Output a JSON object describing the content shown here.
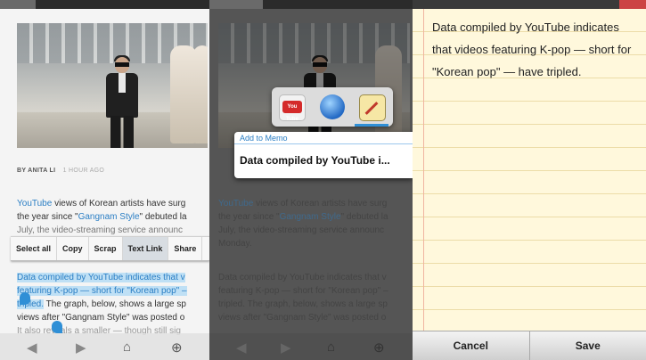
{
  "article": {
    "byline_author": "BY ANITA LI",
    "byline_time": "1 HOUR AGO",
    "para1_line1_link": "YouTube",
    "para1_line1_rest": " views of Korean artists have surg",
    "para1_line2_pre": "the year since \"",
    "para1_line2_link": "Gangnam Style",
    "para1_line2_post": "\" debuted la",
    "para1_line3": "July, the video-streaming service announc",
    "para1_line4": "Monday.",
    "para2_line1": "Data compiled by YouTube indicates that v",
    "para2_line2": "featuring K-pop — short for \"Korean pop\" –",
    "para2_line3_hl": "tripled.",
    "para2_line3_rest": " The graph, below, shows a large sp",
    "para2_line4": "views after \"Gangnam Style\" was posted o",
    "para2_line5": "It also reveals a smaller — though still sig"
  },
  "context_menu": {
    "items": [
      "Select all",
      "Copy",
      "Scrap",
      "Text Link",
      "Share"
    ]
  },
  "share_popup": {
    "icons": [
      "youtube-icon",
      "web-browser-icon",
      "memo-icon"
    ],
    "youtube_label": "You Tube"
  },
  "add_to_memo": {
    "title": "Add to Memo",
    "preview": "Data compiled by YouTube i..."
  },
  "memo": {
    "text": "Data compiled by YouTube indicates that videos featuring K-pop — short for \"Korean pop\" — have tripled.",
    "cancel_label": "Cancel",
    "save_label": "Save"
  },
  "colors": {
    "link": "#2a7ec4",
    "selection_highlight": "#bfe0f5",
    "memo_paper": "#fff8dc"
  }
}
